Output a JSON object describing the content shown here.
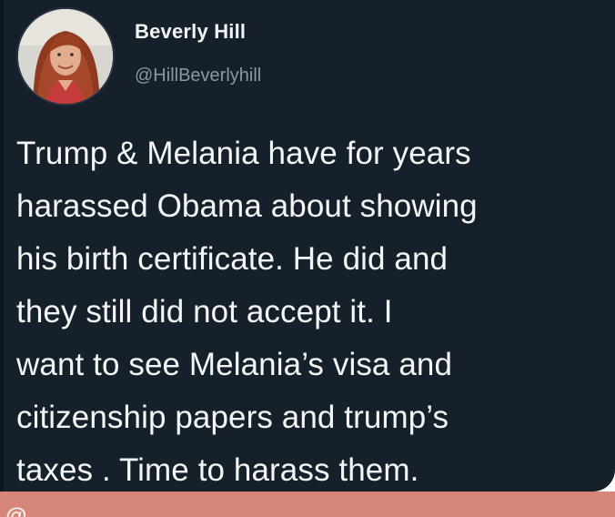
{
  "tweet": {
    "user": {
      "display_name": "Beverly Hill",
      "handle": "@HillBeverlyhill",
      "avatar_icon": "profile-photo"
    },
    "text_lines": [
      "Trump & Melania have for years",
      "harassed Obama about showing",
      "his birth certificate. He did and",
      "they still did not accept it. I",
      "want to see Melania’s visa and",
      "citizenship papers and trump’s",
      "taxes . Time to harass them."
    ]
  },
  "bottom_strip": {
    "partial_text": "@"
  },
  "colors": {
    "card_background": "#15202b",
    "primary_text": "#f3f5f7",
    "secondary_text": "#8899a6",
    "strip_background": "#d7877a"
  }
}
